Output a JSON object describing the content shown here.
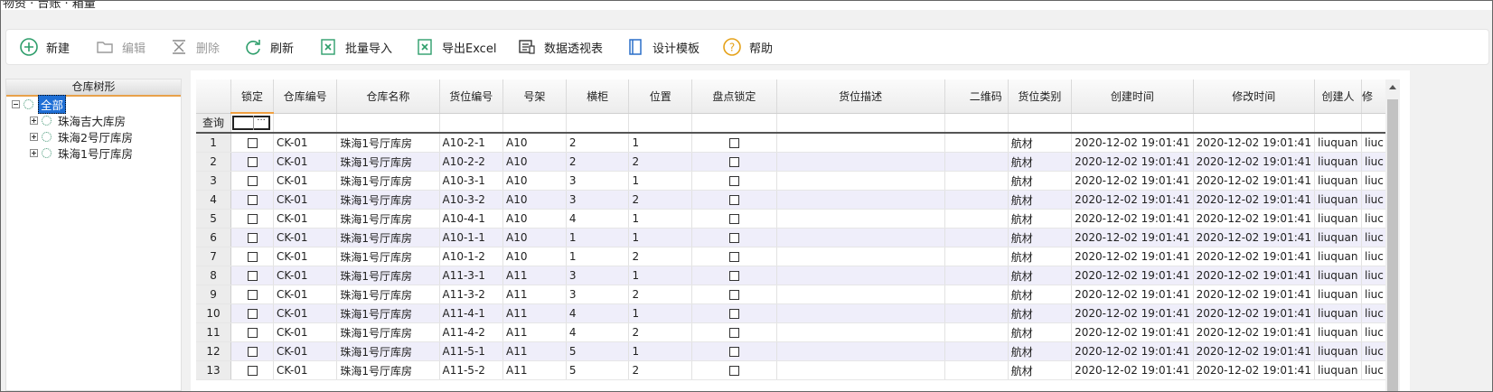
{
  "window": {
    "title": "物资 · 台账 · 箱量"
  },
  "toolbar": {
    "new": "新建",
    "edit": "编辑",
    "delete": "删除",
    "refresh": "刷新",
    "batch_import": "批量导入",
    "export_excel": "导出Excel",
    "pivot": "数据透视表",
    "design_template": "设计模板",
    "help": "帮助"
  },
  "tree": {
    "header": "仓库树形",
    "root": "全部",
    "children": [
      "珠海吉大库房",
      "珠海2号厅库房",
      "珠海1号厅库房"
    ]
  },
  "grid": {
    "filter_label": "查询",
    "filter_button": "···",
    "columns": [
      "锁定",
      "仓库编号",
      "仓库名称",
      "货位编号",
      "号架",
      "横柜",
      "位置",
      "盘点锁定",
      "货位描述",
      "二维码",
      "货位类别",
      "创建时间",
      "修改时间",
      "创建人",
      "修"
    ],
    "rows": [
      {
        "n": "1",
        "wh": "CK-01",
        "name": "珠海1号厅库房",
        "loc": "A10-2-1",
        "rack": "A10",
        "h": "2",
        "pos": "1",
        "cat": "航材",
        "ct": "2020-12-02 19:01:41",
        "mt": "2020-12-02 19:01:41",
        "user": "liuquan",
        "mu": "liuc"
      },
      {
        "n": "2",
        "wh": "CK-01",
        "name": "珠海1号厅库房",
        "loc": "A10-2-2",
        "rack": "A10",
        "h": "2",
        "pos": "2",
        "cat": "航材",
        "ct": "2020-12-02 19:01:41",
        "mt": "2020-12-02 19:01:41",
        "user": "liuquan",
        "mu": "liuc"
      },
      {
        "n": "3",
        "wh": "CK-01",
        "name": "珠海1号厅库房",
        "loc": "A10-3-1",
        "rack": "A10",
        "h": "3",
        "pos": "1",
        "cat": "航材",
        "ct": "2020-12-02 19:01:41",
        "mt": "2020-12-02 19:01:41",
        "user": "liuquan",
        "mu": "liuc"
      },
      {
        "n": "4",
        "wh": "CK-01",
        "name": "珠海1号厅库房",
        "loc": "A10-3-2",
        "rack": "A10",
        "h": "3",
        "pos": "2",
        "cat": "航材",
        "ct": "2020-12-02 19:01:41",
        "mt": "2020-12-02 19:01:41",
        "user": "liuquan",
        "mu": "liuc"
      },
      {
        "n": "5",
        "wh": "CK-01",
        "name": "珠海1号厅库房",
        "loc": "A10-4-1",
        "rack": "A10",
        "h": "4",
        "pos": "1",
        "cat": "航材",
        "ct": "2020-12-02 19:01:41",
        "mt": "2020-12-02 19:01:41",
        "user": "liuquan",
        "mu": "liuc"
      },
      {
        "n": "6",
        "wh": "CK-01",
        "name": "珠海1号厅库房",
        "loc": "A10-1-1",
        "rack": "A10",
        "h": "1",
        "pos": "1",
        "cat": "航材",
        "ct": "2020-12-02 19:01:41",
        "mt": "2020-12-02 19:01:41",
        "user": "liuquan",
        "mu": "liuc"
      },
      {
        "n": "7",
        "wh": "CK-01",
        "name": "珠海1号厅库房",
        "loc": "A10-1-2",
        "rack": "A10",
        "h": "1",
        "pos": "2",
        "cat": "航材",
        "ct": "2020-12-02 19:01:41",
        "mt": "2020-12-02 19:01:41",
        "user": "liuquan",
        "mu": "liuc"
      },
      {
        "n": "8",
        "wh": "CK-01",
        "name": "珠海1号厅库房",
        "loc": "A11-3-1",
        "rack": "A11",
        "h": "3",
        "pos": "1",
        "cat": "航材",
        "ct": "2020-12-02 19:01:41",
        "mt": "2020-12-02 19:01:41",
        "user": "liuquan",
        "mu": "liuc"
      },
      {
        "n": "9",
        "wh": "CK-01",
        "name": "珠海1号厅库房",
        "loc": "A11-3-2",
        "rack": "A11",
        "h": "3",
        "pos": "2",
        "cat": "航材",
        "ct": "2020-12-02 19:01:41",
        "mt": "2020-12-02 19:01:41",
        "user": "liuquan",
        "mu": "liuc"
      },
      {
        "n": "10",
        "wh": "CK-01",
        "name": "珠海1号厅库房",
        "loc": "A11-4-1",
        "rack": "A11",
        "h": "4",
        "pos": "1",
        "cat": "航材",
        "ct": "2020-12-02 19:01:41",
        "mt": "2020-12-02 19:01:41",
        "user": "liuquan",
        "mu": "liuc"
      },
      {
        "n": "11",
        "wh": "CK-01",
        "name": "珠海1号厅库房",
        "loc": "A11-4-2",
        "rack": "A11",
        "h": "4",
        "pos": "2",
        "cat": "航材",
        "ct": "2020-12-02 19:01:41",
        "mt": "2020-12-02 19:01:41",
        "user": "liuquan",
        "mu": "liuc"
      },
      {
        "n": "12",
        "wh": "CK-01",
        "name": "珠海1号厅库房",
        "loc": "A11-5-1",
        "rack": "A11",
        "h": "5",
        "pos": "1",
        "cat": "航材",
        "ct": "2020-12-02 19:01:41",
        "mt": "2020-12-02 19:01:41",
        "user": "liuquan",
        "mu": "liuc"
      },
      {
        "n": "13",
        "wh": "CK-01",
        "name": "珠海1号厅库房",
        "loc": "A11-5-2",
        "rack": "A11",
        "h": "5",
        "pos": "2",
        "cat": "航材",
        "ct": "2020-12-02 19:01:41",
        "mt": "2020-12-02 19:01:41",
        "user": "liuquan",
        "mu": "liuc"
      }
    ]
  },
  "colors": {
    "accent_green": "#2e9e6b",
    "accent_blue": "#2a6fc9",
    "selected": "#1e6fd6",
    "header_underline": "#e8a14a"
  }
}
